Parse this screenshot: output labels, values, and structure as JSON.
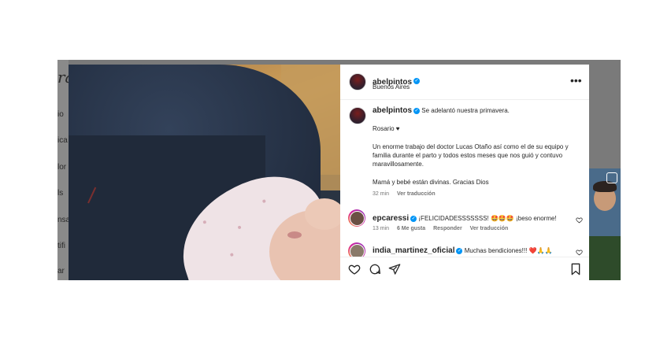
{
  "background": {
    "logo": "ra",
    "nav_fragments": [
      "io",
      "ica",
      "lor",
      "ls",
      "nsa",
      "tifi",
      "ar"
    ]
  },
  "post": {
    "author": "abelpintos",
    "location": "Buenos Aires",
    "caption_lines": [
      "Se adelantó nuestra primavera.",
      "Rosario ♥",
      "Un enorme trabajo del doctor Lucas Otaño así como el de su equipo y familia durante el parto y todos estos meses que nos guió y contuvo maravillosamente.",
      "Mamá y bebé están divinas. Gracias Dios"
    ],
    "caption_time": "32 min",
    "see_translation": "Ver traducción"
  },
  "comments": [
    {
      "user": "epcaressi",
      "text": "¡FELICIDADESSSSSSS! 🤩🤩🤩 ¡beso enorme!",
      "time": "13 min",
      "likes": "6 Me gusta",
      "reply": "Responder",
      "translate": "Ver traducción"
    },
    {
      "user": "india_martinez_oficial",
      "text": "Muchas bendiciones!!! ❤️🙏🙏"
    }
  ],
  "icons": [
    "more-icon",
    "verified-icon",
    "heart-icon",
    "comment-icon",
    "share-icon",
    "bookmark-icon"
  ],
  "colors": {
    "verified": "#0095f6",
    "text": "#262626",
    "muted": "#737373"
  }
}
